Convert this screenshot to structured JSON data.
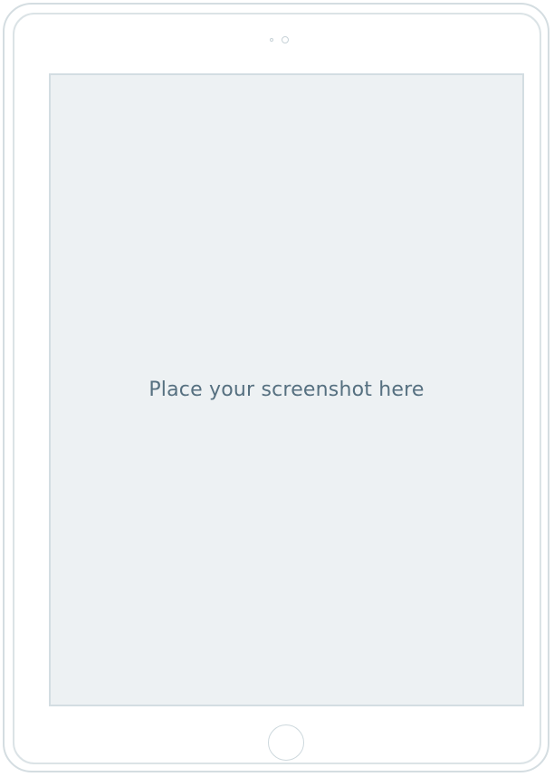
{
  "device": {
    "type": "tablet",
    "camera_icon": "camera-dots-icon",
    "home_button_icon": "home-button-icon"
  },
  "screen": {
    "placeholder_text": "Place your screenshot here"
  },
  "colors": {
    "frame": "#d4dde1",
    "screen_background": "#edf1f3",
    "placeholder_text": "#567080"
  }
}
